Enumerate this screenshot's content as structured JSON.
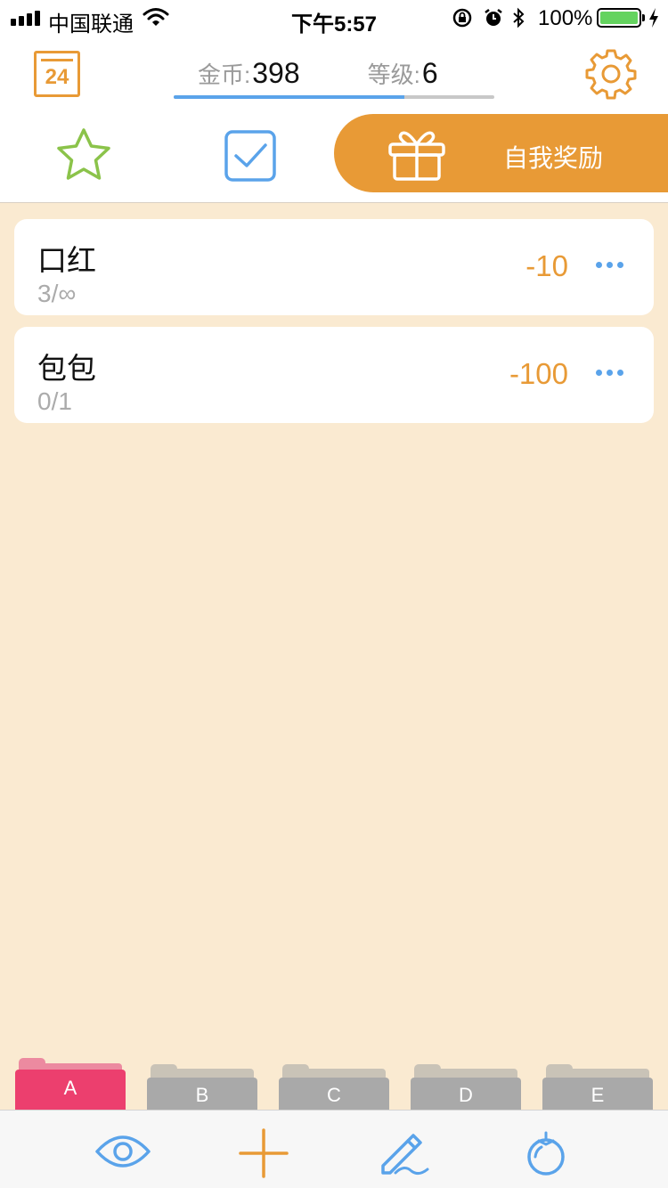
{
  "status_bar": {
    "carrier": "中国联通",
    "time": "下午5:57",
    "battery": "100%"
  },
  "header": {
    "calendar_day": "24",
    "coins_label": "金币:",
    "coins_value": "398",
    "level_label": "等级:",
    "level_value": "6",
    "level_progress": 0.72
  },
  "tabs": {
    "reward_label": "自我奖励"
  },
  "rewards": [
    {
      "name": "口红",
      "count": "3/∞",
      "cost": "-10"
    },
    {
      "name": "包包",
      "count": "0/1",
      "cost": "-100"
    }
  ],
  "folders": [
    {
      "label": "A",
      "active": true
    },
    {
      "label": "B",
      "active": false
    },
    {
      "label": "C",
      "active": false
    },
    {
      "label": "D",
      "active": false
    },
    {
      "label": "E",
      "active": false
    }
  ],
  "toolbar": {
    "icons": [
      "eye-icon",
      "plus-icon",
      "edit-icon",
      "tomato-icon"
    ]
  },
  "colors": {
    "accent_orange": "#e89a36",
    "accent_blue": "#5aa3ea",
    "accent_green": "#8bc34a",
    "folder_active": "#ec3f6e",
    "background": "#faead1"
  }
}
